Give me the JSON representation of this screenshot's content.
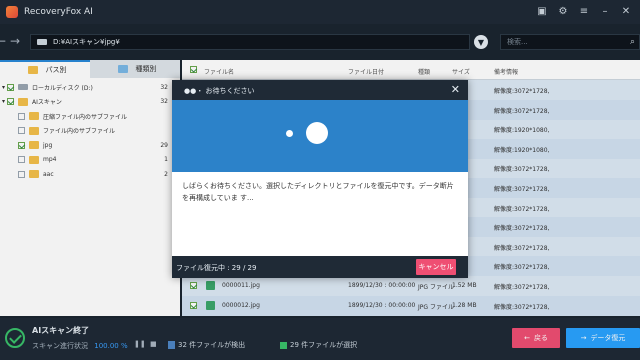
{
  "app": {
    "title": "RecoveryFox AI",
    "title_icons": [
      "feedback-icon",
      "gear-icon",
      "menu-icon",
      "minimize-icon",
      "close-icon"
    ]
  },
  "path": {
    "value": "D:¥AIスキャン¥jpg¥",
    "search_placeholder": "検索..."
  },
  "tabs": [
    {
      "label": "パス別"
    },
    {
      "label": "種類別"
    }
  ],
  "tree": [
    {
      "label": "ローカルディスク (D:)",
      "count": "32"
    },
    {
      "label": "AIスキャン",
      "count": "32"
    },
    {
      "label": "圧縮ファイル内のサブファイル",
      "count": ""
    },
    {
      "label": "ファイル内のサブファイル",
      "count": ""
    },
    {
      "label": "jpg",
      "count": "29"
    },
    {
      "label": "mp4",
      "count": "1"
    },
    {
      "label": "aac",
      "count": "2"
    }
  ],
  "table": {
    "headers": {
      "name": "ファイル名",
      "date": "ファイル日付",
      "type": "種類",
      "size": "サイズ",
      "info": "備考情報"
    },
    "rows": [
      {
        "name": "",
        "date": "",
        "type": "",
        "size": "",
        "info": "解像度:3072*1728,"
      },
      {
        "name": "",
        "date": "",
        "type": "",
        "size": "",
        "info": "解像度:3072*1728,"
      },
      {
        "name": "",
        "date": "",
        "type": "",
        "size": "",
        "info": "解像度:1920*1080,"
      },
      {
        "name": "",
        "date": "",
        "type": "",
        "size": "",
        "info": "解像度:1920*1080,"
      },
      {
        "name": "",
        "date": "",
        "type": "",
        "size": "",
        "info": "解像度:3072*1728,"
      },
      {
        "name": "",
        "date": "",
        "type": "",
        "size": "",
        "info": "解像度:3072*1728,"
      },
      {
        "name": "",
        "date": "",
        "type": "",
        "size": "",
        "info": "解像度:3072*1728,"
      },
      {
        "name": "",
        "date": "",
        "type": "",
        "size": "",
        "info": "解像度:3072*1728,"
      },
      {
        "name": "",
        "date": "",
        "type": "",
        "size": "",
        "info": "解像度:3072*1728,"
      },
      {
        "name": "",
        "date": "",
        "type": "",
        "size": "",
        "info": "解像度:3072*1728,"
      },
      {
        "name": "0000011.jpg",
        "date": "1899/12/30 : 00:00:00",
        "type": "JPG ファイル",
        "size": "1.52 MB",
        "info": "解像度:3072*1728,"
      },
      {
        "name": "0000012.jpg",
        "date": "1899/12/30 : 00:00:00",
        "type": "JPG ファイル",
        "size": "1.28 MB",
        "info": "解像度:3072*1728,"
      }
    ]
  },
  "modal": {
    "title": "●●・ お待ちください",
    "message": "しばらくお待ちください。選択したディレクトリとファイルを復元中です。データ断片を再構成していま す...",
    "progress": "ファイル復元中 : 29 / 29",
    "cancel": "キャンセル"
  },
  "bottom": {
    "title": "AIスキャン終了",
    "status_label": "スキャン進行状況",
    "status_value": "100.00 %",
    "found": "32 件ファイルが検出",
    "selected": "29 件ファイルが選択",
    "back": "戻る",
    "recover": "データ復元"
  },
  "colors": {
    "accent": "#2aa3ff",
    "danger": "#ef4f73",
    "modal_art": "#2c82c9",
    "success": "#3ac06b"
  }
}
